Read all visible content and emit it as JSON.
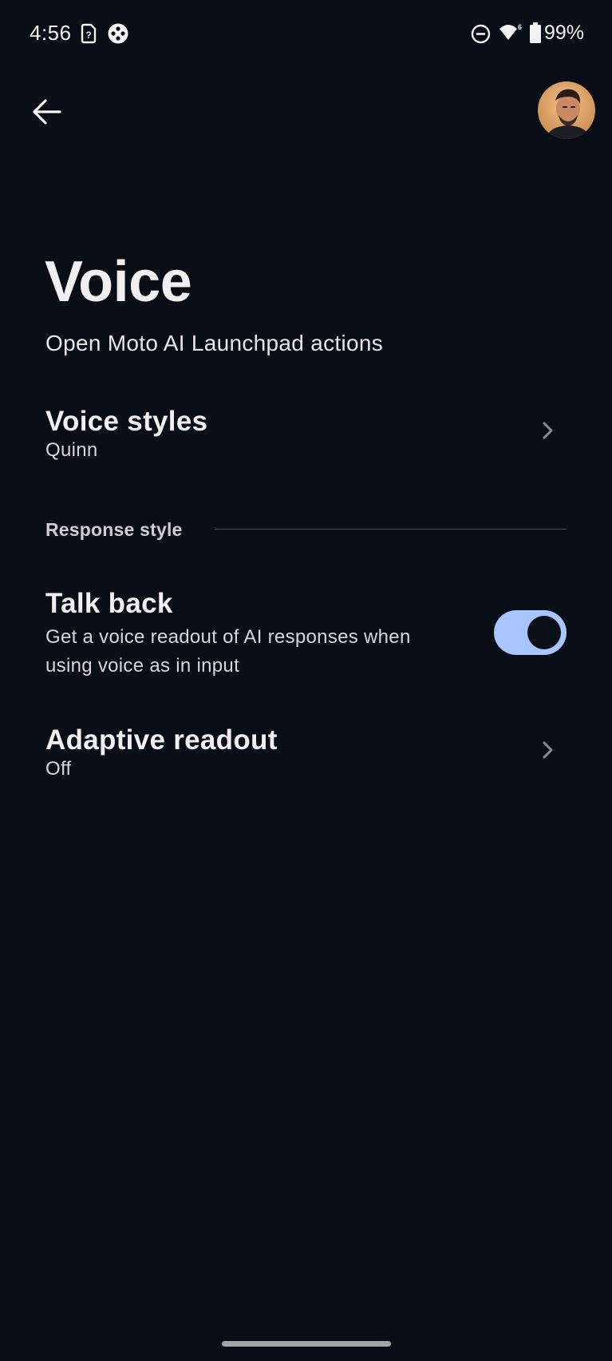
{
  "status_bar": {
    "time": "4:56",
    "battery": "99%",
    "icons": [
      "sim-question-icon",
      "game-controller-icon",
      "do-not-disturb-icon",
      "wifi-icon",
      "battery-icon"
    ]
  },
  "top_bar": {
    "back_icon": "arrow-left-icon",
    "avatar": "profile-avatar"
  },
  "page": {
    "title": "Voice",
    "subtitle": "Open Moto AI Launchpad actions"
  },
  "settings": {
    "voice_styles": {
      "title": "Voice styles",
      "value": "Quinn"
    },
    "section_response": "Response style",
    "talk_back": {
      "title": "Talk back",
      "description_line1": "Get a voice readout of AI responses when",
      "description_line2": "using voice as in input",
      "enabled": true
    },
    "adaptive_readout": {
      "title": "Adaptive readout",
      "value": "Off"
    }
  },
  "colors": {
    "background": "#090d16",
    "toggle_on": "#a7c5ff",
    "text_primary": "#f1eff3"
  }
}
